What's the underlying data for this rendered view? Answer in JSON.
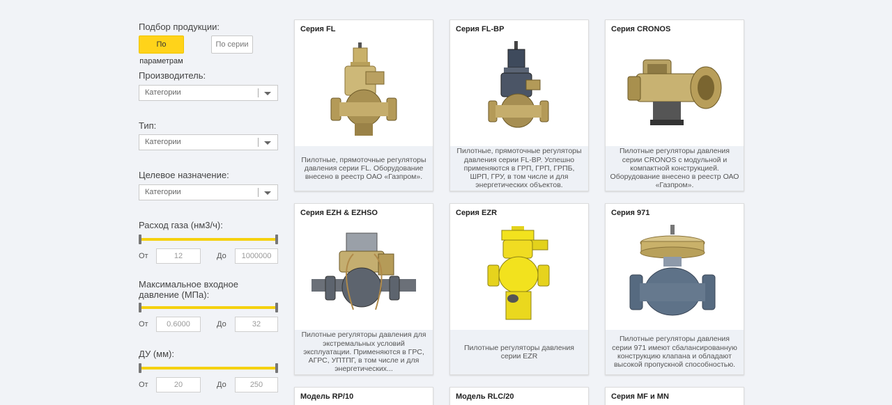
{
  "filter": {
    "title": "Подбор продукции:",
    "tab_params": "По параметрам",
    "tab_series": "По серии",
    "manufacturer": {
      "label": "Производитель:",
      "value": "Категории"
    },
    "type": {
      "label": "Тип:",
      "value": "Категории"
    },
    "purpose": {
      "label": "Целевое назначение:",
      "value": "Категории"
    },
    "gas_flow": {
      "label": "Расход газа (нм3/ч):",
      "from_label": "От",
      "to_label": "До",
      "from": "12",
      "to": "1000000"
    },
    "max_pressure": {
      "label": "Максимальное входное давление (МПа):",
      "from_label": "От",
      "to_label": "До",
      "from": "0.6000",
      "to": "32"
    },
    "du": {
      "label": "ДУ (мм):",
      "from_label": "От",
      "to_label": "До",
      "from": "20",
      "to": "250"
    }
  },
  "products": [
    {
      "title": "Серия FL",
      "image": "regulator-fl-icon",
      "desc": "Пилотные, прямоточные регуляторы давления серии FL. Оборудование внесено в реестр ОАО «Газпром»."
    },
    {
      "title": "Серия FL-BP",
      "image": "regulator-fl-bp-icon",
      "desc": "Пилотные, прямоточные регуляторы давления серии FL-BP. Успешно применяются в ГРП, ГРП, ГРПБ, ШРП, ГРУ, в том числе и для энергетических объектов."
    },
    {
      "title": "Серия CRONOS",
      "image": "regulator-cronos-icon",
      "desc": "Пилотные регуляторы давления серии CRONOS с модульной и компактной конструкцией. Оборудование внесено в реестр ОАО «Газпром»."
    },
    {
      "title": "Серия EZH & EZHSO",
      "image": "regulator-ezh-icon",
      "desc": "Пилотные регуляторы давления для экстремальных условий эксплуатации. Применяются в ГРС, АГРС, УПТПГ, в том числе и для энергетических..."
    },
    {
      "title": "Серия EZR",
      "image": "regulator-ezr-icon",
      "desc": "Пилотные регуляторы давления серии EZR"
    },
    {
      "title": "Серия 971",
      "image": "regulator-971-icon",
      "desc": "Пилотные регуляторы давления серии 971 имеют сбалансированную конструкцию клапана и обладают высокой пропускной способностью."
    },
    {
      "title": "Модель RP/10"
    },
    {
      "title": "Модель RLC/20"
    },
    {
      "title": "Серия MF и MN"
    }
  ]
}
